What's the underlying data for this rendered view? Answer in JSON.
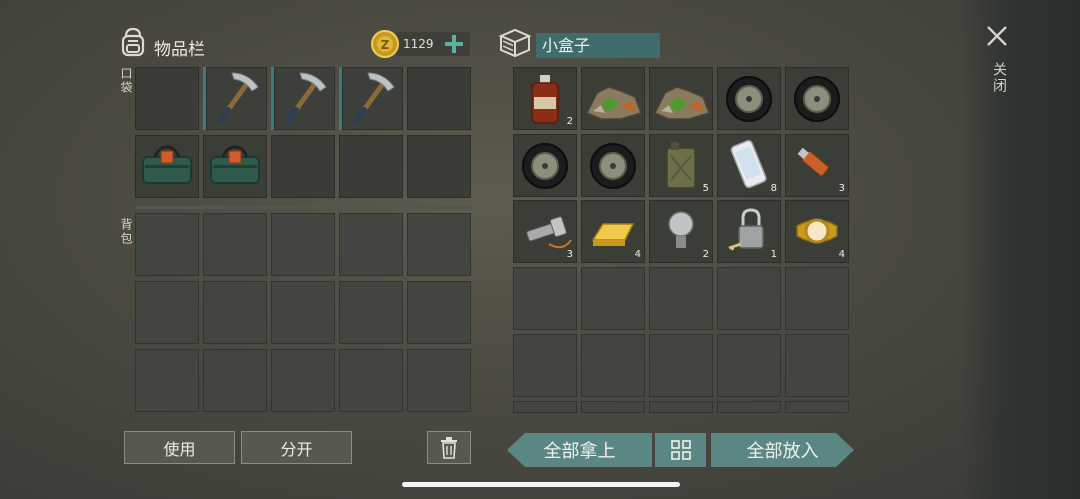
{
  "inventory": {
    "title": "物品栏",
    "coins": "1129",
    "pocket_label": "口袋",
    "backpack_label": "背包",
    "use_label": "使用",
    "split_label": "分开"
  },
  "container": {
    "name": "小盒子",
    "take_all_label": "全部拿上",
    "put_all_label": "全部放入",
    "items": [
      {
        "icon": "medicine-bottle-icon",
        "count": "2"
      },
      {
        "icon": "scrap-pile-icon",
        "count": ""
      },
      {
        "icon": "scrap-pile-icon",
        "count": ""
      },
      {
        "icon": "car-wheel-icon",
        "count": ""
      },
      {
        "icon": "car-wheel-icon",
        "count": ""
      },
      {
        "icon": "car-wheel-icon",
        "count": ""
      },
      {
        "icon": "car-wheel-icon",
        "count": ""
      },
      {
        "icon": "jerry-can-icon",
        "count": "5"
      },
      {
        "icon": "smartphone-icon",
        "count": "8"
      },
      {
        "icon": "usb-drive-icon",
        "count": "3"
      },
      {
        "icon": "flashlight-icon",
        "count": "3"
      },
      {
        "icon": "gold-bar-icon",
        "count": "4"
      },
      {
        "icon": "light-bulb-icon",
        "count": "2"
      },
      {
        "icon": "padlock-icon",
        "count": "1"
      },
      {
        "icon": "gold-watch-icon",
        "count": "4"
      }
    ]
  },
  "close_label": "关闭",
  "colors": {
    "accent": "#5a8784",
    "field": "#3f6d6d",
    "coin": "#d8a929",
    "plus": "#5fb0a2"
  }
}
